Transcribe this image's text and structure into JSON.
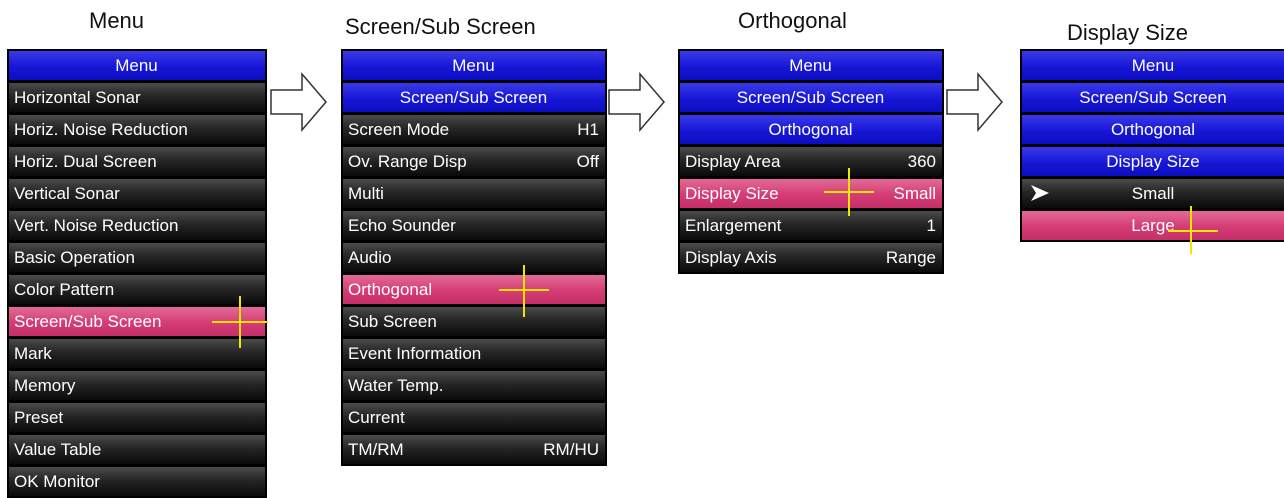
{
  "captions": {
    "menu": "Menu",
    "screen_sub": "Screen/Sub Screen",
    "orthogonal": "Orthogonal",
    "display_size": "Display Size"
  },
  "panel1": {
    "header": "Menu",
    "items": [
      {
        "label": "Horizontal Sonar"
      },
      {
        "label": "Horiz. Noise Reduction"
      },
      {
        "label": "Horiz. Dual Screen"
      },
      {
        "label": "Vertical Sonar"
      },
      {
        "label": "Vert. Noise Reduction"
      },
      {
        "label": "Basic Operation"
      },
      {
        "label": "Color Pattern"
      },
      {
        "label": "Screen/Sub Screen",
        "selected": true
      },
      {
        "label": "Mark"
      },
      {
        "label": "Memory"
      },
      {
        "label": "Preset"
      },
      {
        "label": "Value Table"
      },
      {
        "label": "OK Monitor"
      }
    ]
  },
  "panel2": {
    "headers": [
      "Menu",
      "Screen/Sub Screen"
    ],
    "items": [
      {
        "label": "Screen Mode",
        "value": "H1"
      },
      {
        "label": "Ov. Range Disp",
        "value": "Off"
      },
      {
        "label": "Multi",
        "value": ""
      },
      {
        "label": "Echo Sounder",
        "value": ""
      },
      {
        "label": "Audio",
        "value": ""
      },
      {
        "label": "Orthogonal",
        "value": "",
        "selected": true
      },
      {
        "label": "Sub Screen",
        "value": ""
      },
      {
        "label": "Event Information",
        "value": ""
      },
      {
        "label": "Water Temp.",
        "value": ""
      },
      {
        "label": "Current",
        "value": ""
      },
      {
        "label": "TM/RM",
        "value": "RM/HU"
      }
    ]
  },
  "panel3": {
    "headers": [
      "Menu",
      "Screen/Sub Screen",
      "Orthogonal"
    ],
    "items": [
      {
        "label": "Display Area",
        "value": "360"
      },
      {
        "label": "Display Size",
        "value": "Small",
        "selected": true
      },
      {
        "label": "Enlargement",
        "value": "1"
      },
      {
        "label": "Display Axis",
        "value": "Range"
      }
    ]
  },
  "panel4": {
    "headers": [
      "Menu",
      "Screen/Sub Screen",
      "Orthogonal",
      "Display Size"
    ],
    "options": [
      {
        "label": "Small",
        "checked": true
      },
      {
        "label": "Large",
        "selected": true
      }
    ]
  },
  "icons": {
    "flow_arrow": "right-arrow-icon",
    "check_mark": "check-arrow-icon",
    "cursor": "crosshair-cursor-icon"
  },
  "colors": {
    "header_blue": "#1616d8",
    "selected_pink": "#d43c74",
    "cursor_yellow": "#f2e600",
    "row_dark": "#262626"
  }
}
